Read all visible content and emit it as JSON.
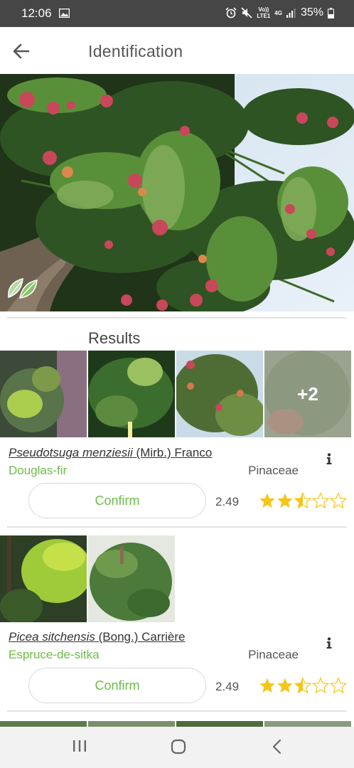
{
  "status_bar": {
    "time": "12:06",
    "network_top": "Vo))",
    "network_bottom": "LTE1",
    "net_4g": "4G",
    "battery": "35%"
  },
  "app_bar": {
    "title": "Identification",
    "back_icon": "arrow-left-icon"
  },
  "hero": {
    "badge_icon": "leaf-icon"
  },
  "results": {
    "title": "Results",
    "items": [
      {
        "scientific_name": "Pseudotsuga menziesii",
        "author": " (Mirb.) Franco",
        "common_name": "Douglas-fir",
        "family": "Pinaceae",
        "score": "2.49",
        "rating": 2.5,
        "confirm_label": "Confirm",
        "more_images": "+2"
      },
      {
        "scientific_name": "Picea sitchensis",
        "author": " (Bong.) Carrière",
        "common_name": "Espruce-de-sitka",
        "family": "Pinaceae",
        "score": "2.49",
        "rating": 2.5,
        "confirm_label": "Confirm"
      }
    ]
  },
  "colors": {
    "accent_green": "#6cbd45",
    "star_gold": "#f5c518",
    "status_bar": "#464646"
  }
}
